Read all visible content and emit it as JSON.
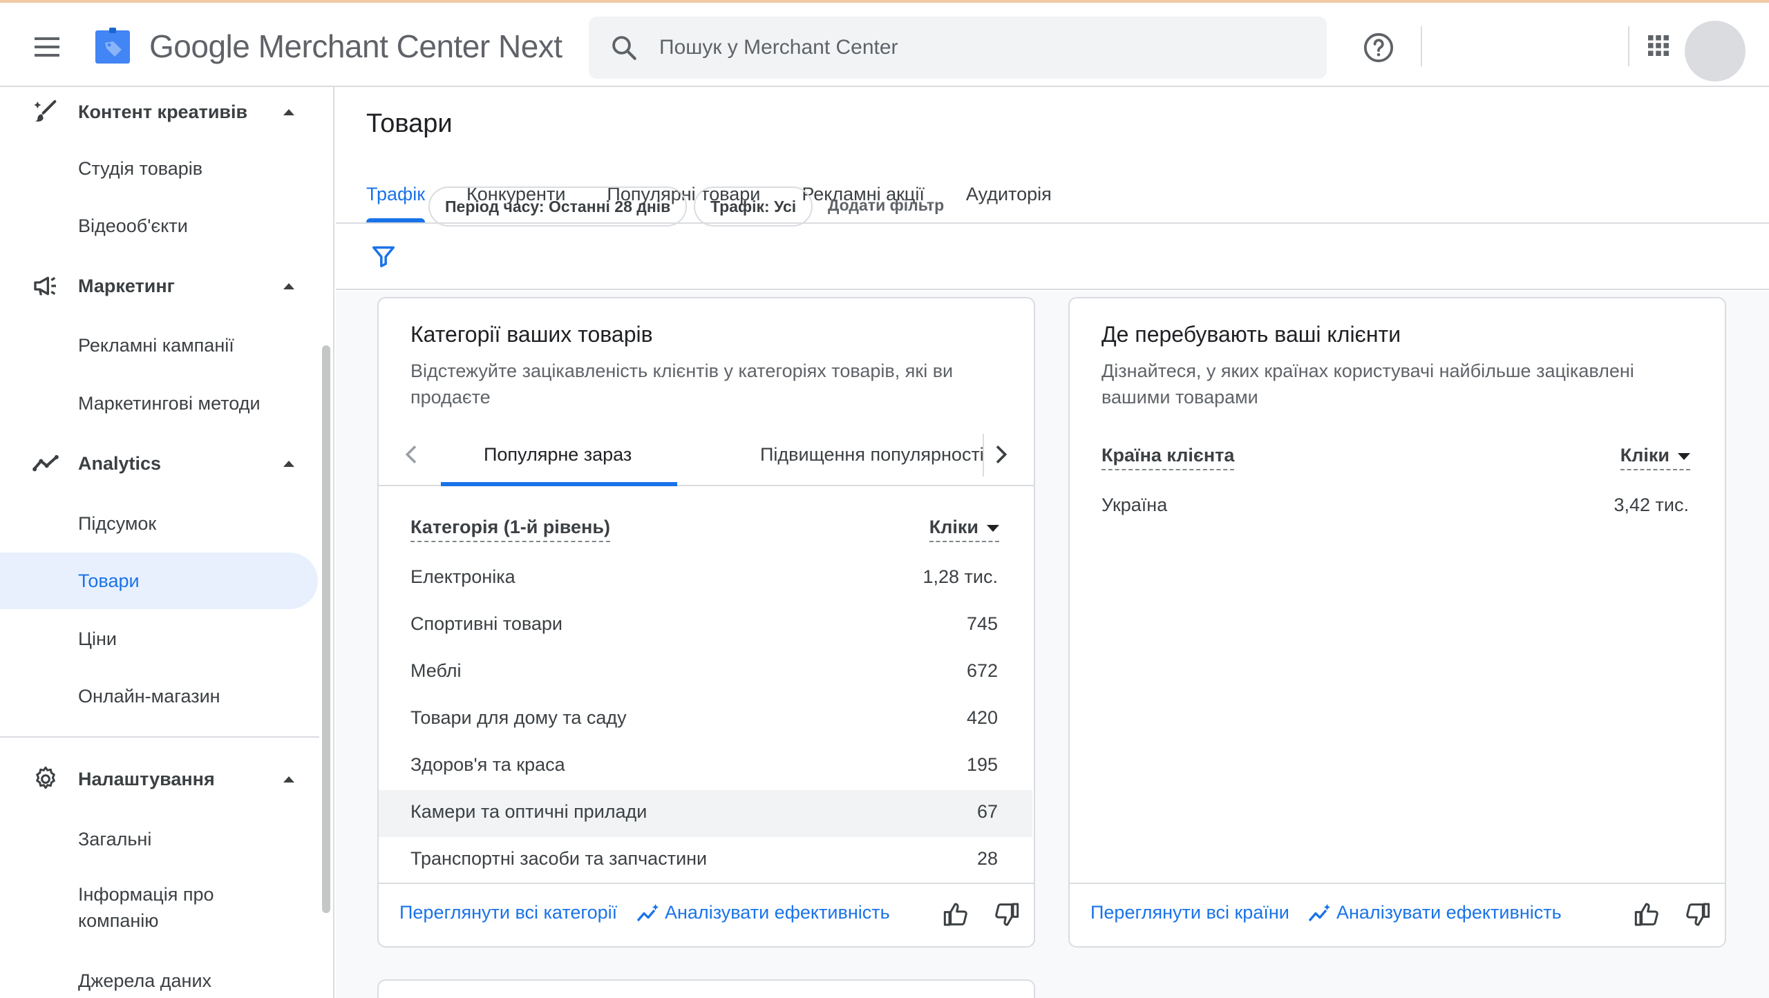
{
  "header": {
    "logo_text": "Google Merchant Center Next",
    "search_placeholder": "Пошук у Merchant Center"
  },
  "sidebar": {
    "sections": [
      {
        "label": "Контент креативів",
        "icon": "creative-brush-icon",
        "items": [
          "Студія товарів",
          "Відеооб'єкти"
        ]
      },
      {
        "label": "Маркетинг",
        "icon": "megaphone-icon",
        "items": [
          "Рекламні кампанії",
          "Маркетингові методи"
        ]
      },
      {
        "label": "Analytics",
        "icon": "trending-line-icon",
        "items": [
          "Підсумок",
          "Товари",
          "Ціни",
          "Онлайн-магазин"
        ]
      },
      {
        "label": "Налаштування",
        "icon": "gear-icon",
        "items": [
          "Загальні",
          "Інформація про компанію",
          "Джерела даних"
        ]
      }
    ],
    "active_item": "Товари"
  },
  "page": {
    "title": "Товари",
    "tabs": [
      "Трафік",
      "Конкуренти",
      "Популярні товари",
      "Рекламні акції",
      "Аудиторія"
    ],
    "active_tab": "Трафік"
  },
  "filters": {
    "chips": [
      "Період часу: Останні 28 днів",
      "Трафік: Усі"
    ],
    "add_filter": "Додати фільтр"
  },
  "categories_card": {
    "title": "Категорії ваших товарів",
    "subtitle": "Відстежуйте зацікавленість клієнтів у категоріях товарів, які ви продаєте",
    "subtabs": [
      "Популярне зараз",
      "Підвищення популярності"
    ],
    "col_category": "Категорія (1-й рівень)",
    "col_clicks": "Кліки",
    "rows": [
      {
        "name": "Електроніка",
        "clicks": "1,28 тис."
      },
      {
        "name": "Спортивні товари",
        "clicks": "745"
      },
      {
        "name": "Меблі",
        "clicks": "672"
      },
      {
        "name": "Товари для дому та саду",
        "clicks": "420"
      },
      {
        "name": "Здоров'я та краса",
        "clicks": "195"
      },
      {
        "name": "Камери та оптичні прилади",
        "clicks": "67"
      },
      {
        "name": "Транспортні засоби та запчастини",
        "clicks": "28"
      }
    ],
    "view_all": "Переглянути всі категорії",
    "analyze": "Аналізувати ефективність"
  },
  "countries_card": {
    "title": "Де перебувають ваші клієнти",
    "subtitle": "Дізнайтеся, у яких країнах користувачі найбільше зацікавлені вашими товарами",
    "col_country": "Країна клієнта",
    "col_clicks": "Кліки",
    "rows": [
      {
        "name": "Україна",
        "clicks": "3,42 тис."
      }
    ],
    "view_all": "Переглянути всі країни",
    "analyze": "Аналізувати ефективність"
  },
  "colors": {
    "accent": "#1a73e8",
    "active_bg": "#e8f0fe",
    "border": "#dadce0"
  }
}
